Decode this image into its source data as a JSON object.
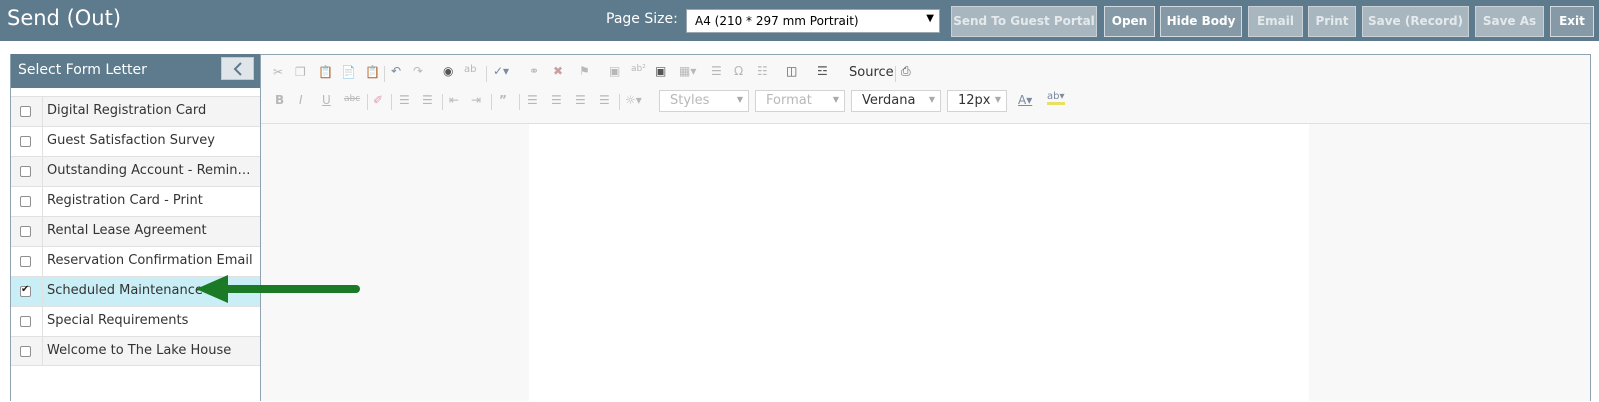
{
  "header": {
    "title": "Send (Out)",
    "page_size_label": "Page Size:",
    "page_size_value": "A4 (210 * 297 mm Portrait)",
    "buttons": {
      "send_to_guest_portal": "Send To Guest Portal",
      "open": "Open",
      "hide_body": "Hide Body",
      "email": "Email",
      "print": "Print",
      "save_record": "Save (Record)",
      "save_as": "Save As",
      "exit": "Exit"
    }
  },
  "sidebar": {
    "title": "Select Form Letter",
    "items": [
      {
        "label": "Digital Registration Card",
        "checked": false
      },
      {
        "label": "Guest Satisfaction Survey",
        "checked": false
      },
      {
        "label": "Outstanding Account - Reminder",
        "checked": false
      },
      {
        "label": "Registration Card - Print",
        "checked": false
      },
      {
        "label": "Rental Lease Agreement",
        "checked": false
      },
      {
        "label": "Reservation Confirmation Email",
        "checked": false
      },
      {
        "label": "Scheduled Maintenance",
        "checked": true
      },
      {
        "label": "Special Requirements",
        "checked": false
      },
      {
        "label": "Welcome to The Lake House",
        "checked": false
      }
    ]
  },
  "editor": {
    "source_label": "Source",
    "styles_combo": "Styles",
    "format_combo": "Format",
    "font_combo": "Verdana",
    "size_combo": "12px"
  },
  "colors": {
    "header_bg": "#5d7b8c",
    "selected_row": "#c9eef5",
    "annotation_arrow": "#1a7a25"
  }
}
